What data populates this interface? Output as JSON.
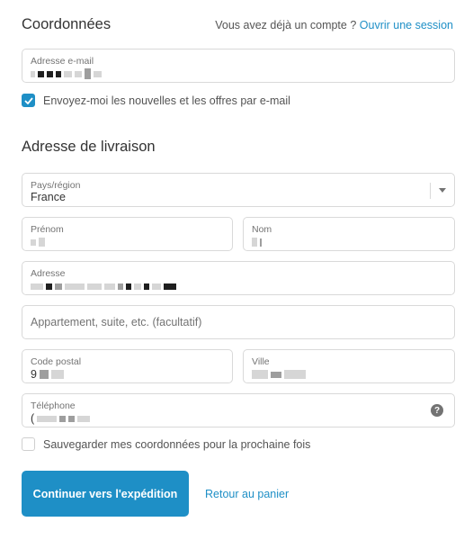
{
  "contact": {
    "title": "Coordonnées",
    "login_prompt": "Vous avez déjà un compte ?",
    "login_link": "Ouvrir une session",
    "email_label": "Adresse e-mail",
    "newsletter_label": "Envoyez-moi les nouvelles et les offres par e-mail",
    "newsletter_checked": true
  },
  "shipping": {
    "title": "Adresse de livraison",
    "country_label": "Pays/région",
    "country_value": "France",
    "first_name_label": "Prénom",
    "last_name_label": "Nom",
    "address_label": "Adresse",
    "apartment_placeholder": "Appartement, suite, etc. (facultatif)",
    "postal_code_label": "Code postal",
    "postal_code_partial": "9",
    "city_label": "Ville",
    "phone_label": "Téléphone",
    "phone_partial": "(",
    "save_label": "Sauvegarder mes coordonnées pour la prochaine fois",
    "save_checked": false
  },
  "actions": {
    "continue_label": "Continuer vers l'expédition",
    "back_label": "Retour au panier"
  },
  "icons": {
    "checkmark": "check-icon",
    "dropdown": "chevron-down-icon",
    "help": "question-circle-icon"
  },
  "colors": {
    "accent": "#1e8fc6",
    "border": "#d9d9d9",
    "text": "#333333",
    "muted": "#737373"
  }
}
